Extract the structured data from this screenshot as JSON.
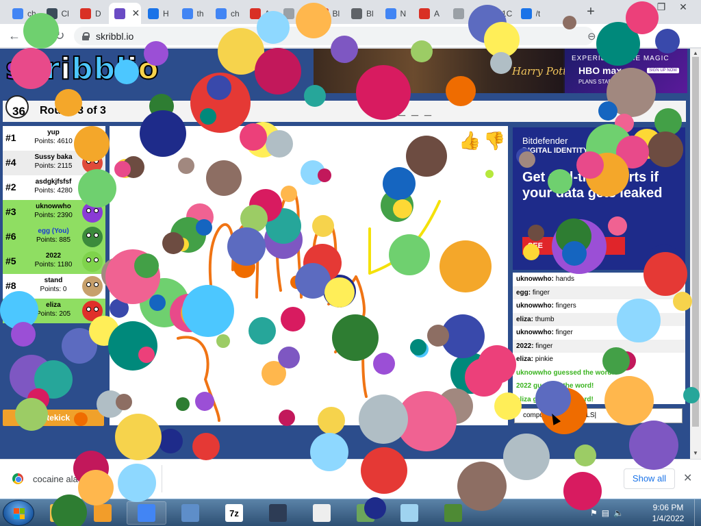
{
  "browser": {
    "tabs": [
      {
        "label": "ch",
        "icon": "google-icon",
        "color": "#4285f4",
        "active": false
      },
      {
        "label": "Cl",
        "icon": "cloudflare-icon",
        "color": "#3b4b5a",
        "active": false
      },
      {
        "label": "D",
        "icon": "gmail-icon",
        "color": "#d93025",
        "active": false
      },
      {
        "label": "",
        "icon": "skribbl-icon",
        "color": "#6a4bc4",
        "active": true
      },
      {
        "label": "H",
        "icon": "h-site-icon",
        "color": "#1a73e8",
        "active": false
      },
      {
        "label": "th",
        "icon": "google-icon",
        "color": "#4285f4",
        "active": false
      },
      {
        "label": "ch",
        "icon": "google-icon",
        "color": "#4285f4",
        "active": false
      },
      {
        "label": "A",
        "icon": "red-g-icon",
        "color": "#d93025",
        "active": false
      },
      {
        "label": "S",
        "icon": "page-icon",
        "color": "#9aa0a6",
        "active": false
      },
      {
        "label": "Bl",
        "icon": "red-g-icon",
        "color": "#d93025",
        "active": false
      },
      {
        "label": "Bl",
        "icon": "globe-icon",
        "color": "#5f6368",
        "active": false
      },
      {
        "label": "N",
        "icon": "google-icon",
        "color": "#4285f4",
        "active": false
      },
      {
        "label": "A",
        "icon": "red-g-icon",
        "color": "#d93025",
        "active": false
      },
      {
        "label": "",
        "icon": "page-icon",
        "color": "#9aa0a6",
        "active": false
      },
      {
        "label": "1C",
        "icon": "page-icon",
        "color": "#9aa0a6",
        "active": false
      },
      {
        "label": "/t",
        "icon": "cloud-upload-icon",
        "color": "#1a73e8",
        "active": false
      }
    ],
    "new_tab": "+",
    "url": "skribbl.io"
  },
  "game": {
    "logo_letters": [
      "s",
      "k",
      "r",
      "i",
      "b",
      "b",
      "l",
      "i",
      "o"
    ],
    "logo_colors": [
      "#8a3bd6",
      "#ffffff",
      "#4cc7ff",
      "#ffffff",
      "#4cc7ff",
      "#4cc7ff",
      "#4cc7ff",
      "#ffffff",
      "#f6d34c"
    ],
    "timer": "36",
    "round": "Round 3 of 3",
    "word_hint": "_ _ _ _ _",
    "votekick": "Votekick",
    "players": [
      {
        "rank": "#1",
        "name": "yup",
        "points": "Points: 4610",
        "state": "normal",
        "avatar": "#e89a3a"
      },
      {
        "rank": "#4",
        "name": "Sussy baka",
        "points": "Points: 2115",
        "state": "alt",
        "avatar": "#e04a3a"
      },
      {
        "rank": "#2",
        "name": "asdgkjfsfsf",
        "points": "Points: 4280",
        "state": "normal",
        "avatar": "#c34fcf"
      },
      {
        "rank": "#3",
        "name": "uknowwho",
        "points": "Points: 2390",
        "state": "guessed",
        "avatar": "#8a3bd6"
      },
      {
        "rank": "#6",
        "name": "egg (You)",
        "points": "Points: 885",
        "state": "me",
        "avatar": "#3c8a3c"
      },
      {
        "rank": "#5",
        "name": "2022",
        "points": "Points: 1180",
        "state": "guessed",
        "avatar": "#7fd34c"
      },
      {
        "rank": "#8",
        "name": "stand",
        "points": "Points: 0",
        "state": "normal",
        "avatar": "#c7a06c"
      },
      {
        "rank": "",
        "name": "eliza",
        "points": "Points: 205",
        "state": "guessed",
        "avatar": "#e0302a"
      }
    ],
    "chat": [
      {
        "user": "uknowwho:",
        "text": "hands",
        "kind": "normal"
      },
      {
        "user": "egg:",
        "text": "finger",
        "kind": "alt"
      },
      {
        "user": "uknowwho:",
        "text": "fingers",
        "kind": "normal"
      },
      {
        "user": "eliza:",
        "text": "thumb",
        "kind": "alt"
      },
      {
        "user": "uknowwho:",
        "text": "finger",
        "kind": "normal"
      },
      {
        "user": "2022:",
        "text": "finger",
        "kind": "alt"
      },
      {
        "user": "eliza:",
        "text": "pinkie",
        "kind": "normal"
      },
      {
        "user": "",
        "text": "uknowwho guessed the word!",
        "kind": "sys"
      },
      {
        "user": "",
        "text": "2022 guessed the word!",
        "kind": "sys"
      },
      {
        "user": "",
        "text": "eliza guessed the word!",
        "kind": "sys"
      }
    ],
    "chat_input": "computer with a BALLS|"
  },
  "ads": {
    "top_exp": "EXPERIENCE THE MAGIC",
    "top_brand": "HBO max",
    "top_plans": "PLANS START MONTH",
    "top_signup": "SIGN UP NOW",
    "top_film": "Harry Potter",
    "side_brand": "Bitdefender",
    "side_sub": "DIGITAL IDENTITY",
    "side_headline": "Get real-time alerts if your data gets leaked",
    "side_cta": "SEE"
  },
  "downloads": {
    "file": "cocaine ala",
    "show_all": "Show all"
  },
  "taskbar": {
    "apps": [
      {
        "icon": "explorer-icon",
        "color": "#f1c04b",
        "label": ""
      },
      {
        "icon": "media-player-icon",
        "color": "#f29d2a",
        "label": ""
      },
      {
        "icon": "chrome-icon",
        "color": "#4285f4",
        "label": ""
      },
      {
        "icon": "control-panel-icon",
        "color": "#5e8ec9",
        "label": ""
      },
      {
        "icon": "7zip-icon",
        "color": "#ffffff",
        "label": "7z"
      },
      {
        "icon": "settings-gear-icon",
        "color": "#2d3c55",
        "label": ""
      },
      {
        "icon": "vpn-icon",
        "color": "#eeeeee",
        "label": ""
      },
      {
        "icon": "network-icon",
        "color": "#6ba55b",
        "label": ""
      },
      {
        "icon": "notepad-icon",
        "color": "#9fd3f0",
        "label": ""
      },
      {
        "icon": "minecraft-icon",
        "color": "#4e8a34",
        "label": ""
      }
    ],
    "time": "9:06 PM",
    "date": "1/4/2022"
  },
  "confetti_colors": [
    "#6fd06f",
    "#e84a8a",
    "#f4a72a",
    "#4cc7ff",
    "#9b4fd6",
    "#2e7d32",
    "#1e2b8a",
    "#e53935",
    "#f6d34c",
    "#8ed8ff",
    "#c2185b",
    "#ffb74d",
    "#7e57c2",
    "#26a69a",
    "#d81b60",
    "#9ccc65",
    "#ef6c00",
    "#5c6bc0",
    "#ffee58",
    "#b0bec5",
    "#8d6e63",
    "#00897b",
    "#ec407a",
    "#3949ab",
    "#a1887f",
    "#f06292",
    "#43a047",
    "#1565c0",
    "#fdd835",
    "#6d4c41"
  ]
}
